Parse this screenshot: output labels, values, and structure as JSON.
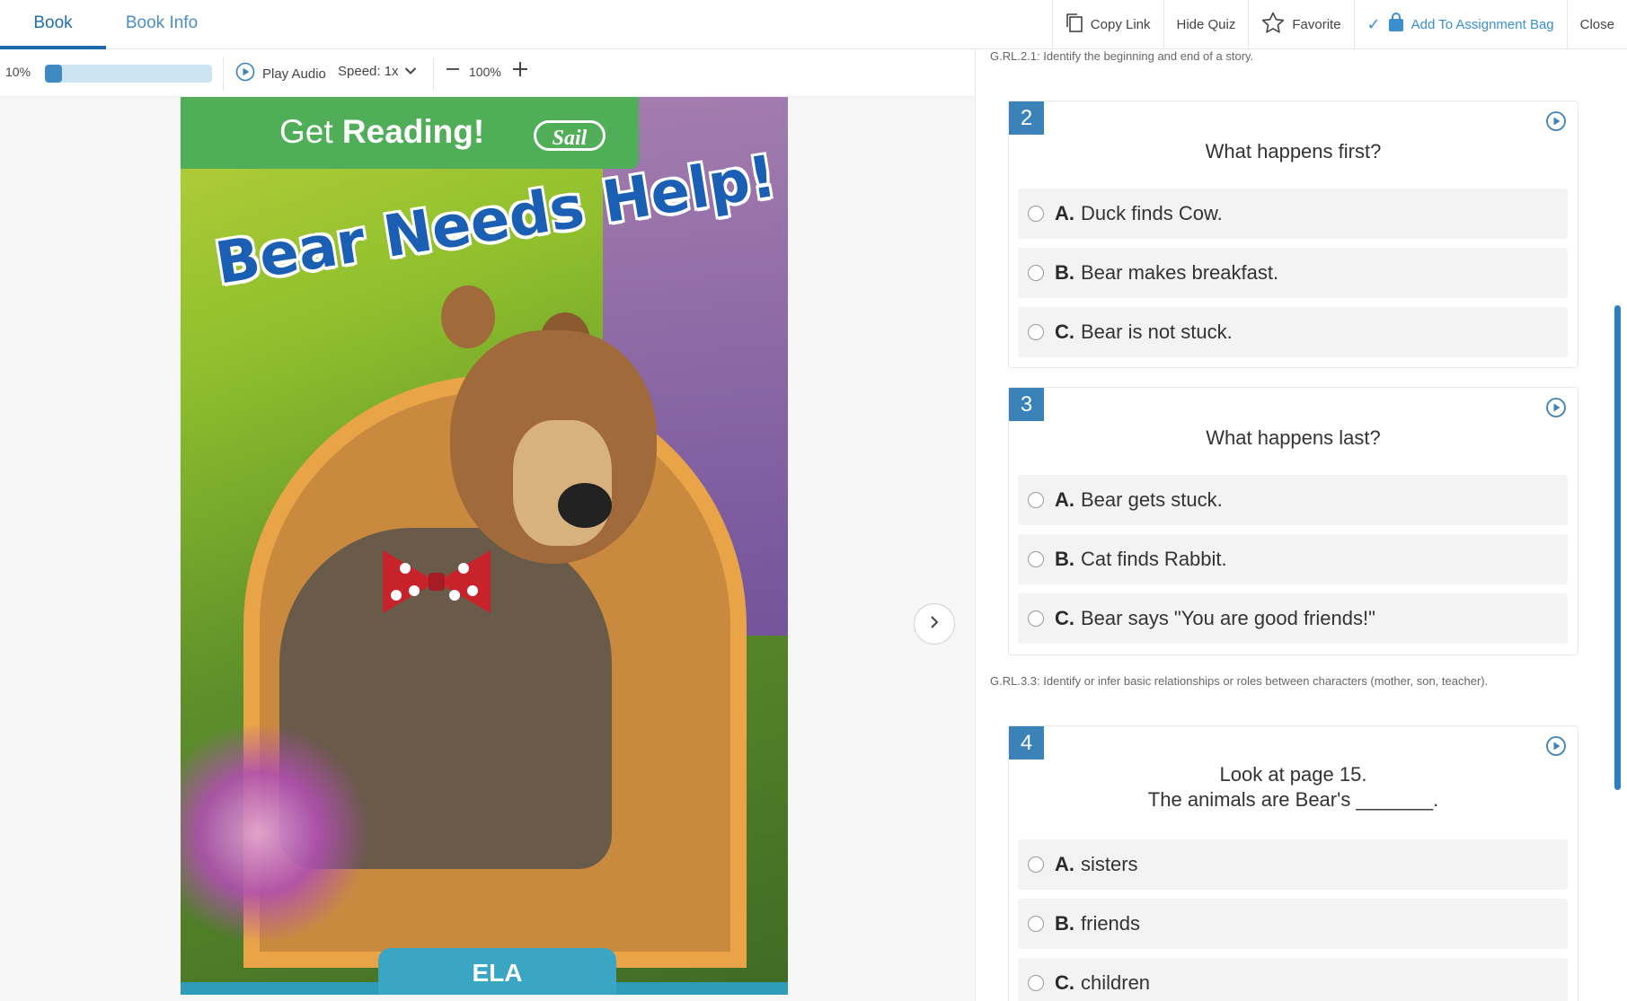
{
  "tabs": [
    {
      "label": "Book"
    },
    {
      "label": "Book Info"
    }
  ],
  "toolbar": {
    "copy_link": "Copy Link",
    "hide_quiz": "Hide Quiz",
    "favorite": "Favorite",
    "add_to_bag": "Add To Assignment Bag",
    "close": "Close"
  },
  "reader": {
    "progress_label": "10%",
    "progress_fraction": 0.1,
    "play_audio": "Play Audio",
    "speed": "Speed: 1x",
    "zoom": "100%"
  },
  "cover": {
    "series": "Get",
    "series_bold": "Reading!",
    "level": "Sail",
    "title": "Bear Needs Help!",
    "subject": "ELA"
  },
  "quiz": {
    "standard_1": "G.RL.2.1: Identify the beginning and end of a story.",
    "standard_2": "G.RL.3.3: Identify or infer basic relationships or roles between characters (mother, son, teacher).",
    "questions": [
      {
        "number": "2",
        "text": "What happens first?",
        "options": [
          {
            "letter": "A.",
            "text": "Duck finds Cow."
          },
          {
            "letter": "B.",
            "text": "Bear makes breakfast."
          },
          {
            "letter": "C.",
            "text": "Bear is not stuck."
          }
        ]
      },
      {
        "number": "3",
        "text": "What happens last?",
        "options": [
          {
            "letter": "A.",
            "text": "Bear gets stuck."
          },
          {
            "letter": "B.",
            "text": "Cat finds Rabbit."
          },
          {
            "letter": "C.",
            "text": "Bear says \"You are good friends!\""
          }
        ]
      },
      {
        "number": "4",
        "text_line1": "Look at page 15.",
        "text_line2": "The animals are Bear's _______.",
        "options": [
          {
            "letter": "A.",
            "text": "sisters"
          },
          {
            "letter": "B.",
            "text": "friends"
          },
          {
            "letter": "C.",
            "text": "children"
          }
        ]
      }
    ]
  },
  "colors": {
    "accent": "#2268ad",
    "qnum_bg": "#3a82b8",
    "cover_banner": "#4fae57",
    "ela_tab": "#3aa6c4"
  }
}
